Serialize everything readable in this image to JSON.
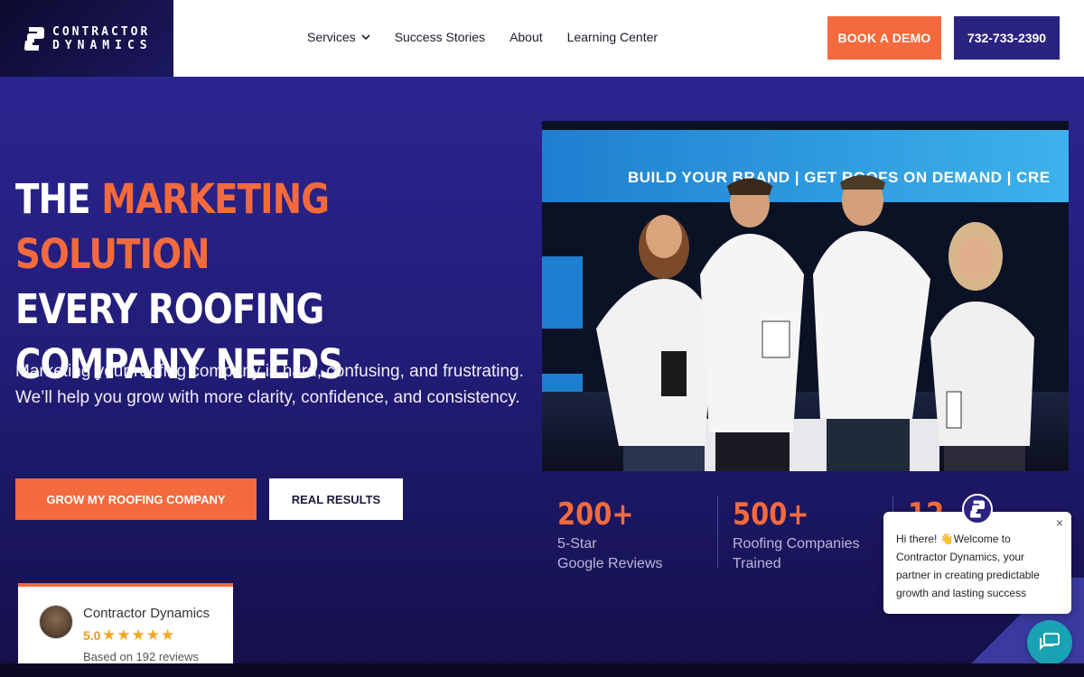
{
  "brand": {
    "logo_line1": "CONTRACTOR",
    "logo_line2": "DYNAMICS",
    "colors": {
      "accent": "#f26a3d",
      "navy": "#2a2480",
      "hero_bg": "#221d78",
      "chat": "#1aa1b4"
    }
  },
  "nav": {
    "items": [
      {
        "label": "Services",
        "icon": "chevron-down-icon"
      },
      {
        "label": "Success Stories"
      },
      {
        "label": "About"
      },
      {
        "label": "Learning Center"
      }
    ],
    "demo_button": "BOOK A DEMO",
    "phone_button": "732-733-2390"
  },
  "hero": {
    "headline_prefix": "THE ",
    "headline_accent": "MARKETING SOLUTION",
    "headline_rest": "EVERY ROOFING COMPANY NEEDS",
    "subtext": "Marketing your roofing company is hard, confusing, and frustrating. We’ll help you grow with more clarity, confidence, and consistency.",
    "primary_cta": "GROW MY ROOFING COMPANY",
    "secondary_cta": "REAL RESULTS",
    "photo_banner": "BUILD YOUR BRAND | GET ROOFS ON DEMAND | CRE"
  },
  "stats": [
    {
      "number": "200+",
      "label_line1": "5-Star",
      "label_line2": "Google Reviews"
    },
    {
      "number": "500+",
      "label_line1": "Roofing Companies",
      "label_line2": "Trained"
    },
    {
      "number": "12"
    }
  ],
  "review_badge": {
    "name": "Contractor Dynamics",
    "score": "5.0",
    "stars": "★★★★★",
    "based_on": "Based on 192 reviews"
  },
  "chat": {
    "message": "Hi there! 👋Welcome to Contractor Dynamics, your partner in creating predictable growth and lasting success",
    "close": "×"
  }
}
